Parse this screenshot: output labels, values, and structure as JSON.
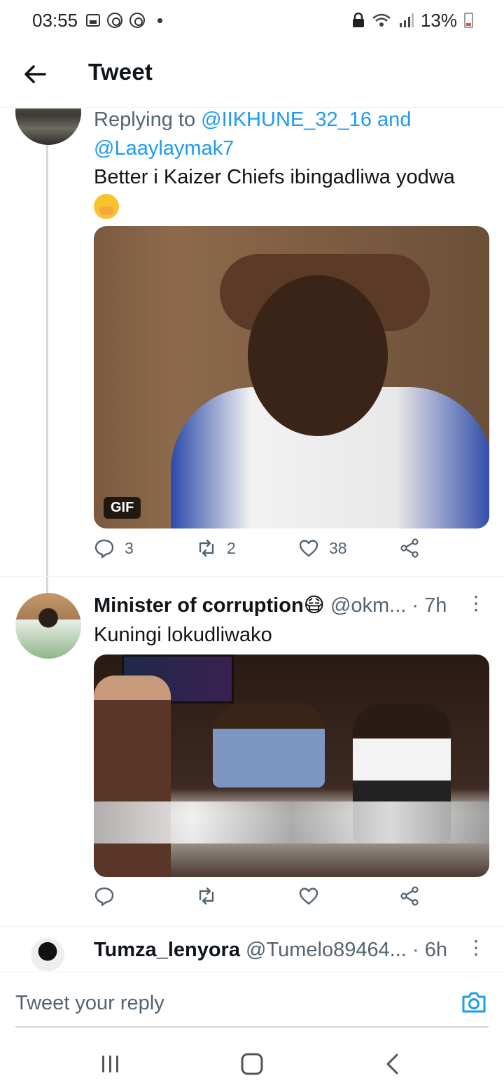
{
  "status_bar": {
    "time": "03:55",
    "battery": "13%",
    "left_icons": [
      "gallery-icon",
      "chrome-icon",
      "chrome-icon",
      "dot-icon"
    ],
    "right_icons": [
      "lock-icon",
      "wifi-icon",
      "signal-icon",
      "battery-icon"
    ]
  },
  "header": {
    "title": "Tweet"
  },
  "tweets": [
    {
      "replying_prefix": "Replying to ",
      "reply_handle_1": "@IIKHUNE_32_16",
      "reply_and": " and ",
      "reply_handle_2": "@Laaylaymak7",
      "text": "Better i Kaizer Chiefs ibingadliwa yodwa",
      "emoji": "face-with-hand-over-mouth",
      "media_badge": "GIF",
      "replies": "3",
      "retweets": "2",
      "likes": "38"
    },
    {
      "name": "Minister of corruption😷",
      "handle": "@okm...",
      "time": "· 7h",
      "text": "Kuningi lokudliwako",
      "replies": "",
      "retweets": "",
      "likes": ""
    },
    {
      "name": "Tumza_lenyora",
      "handle": "@Tumelo89464...",
      "time": "· 6h"
    }
  ],
  "compose": {
    "placeholder": "Tweet your reply"
  },
  "colors": {
    "accent": "#1d9bf0",
    "secondary_text": "#536471",
    "primary_text": "#0f1419"
  }
}
